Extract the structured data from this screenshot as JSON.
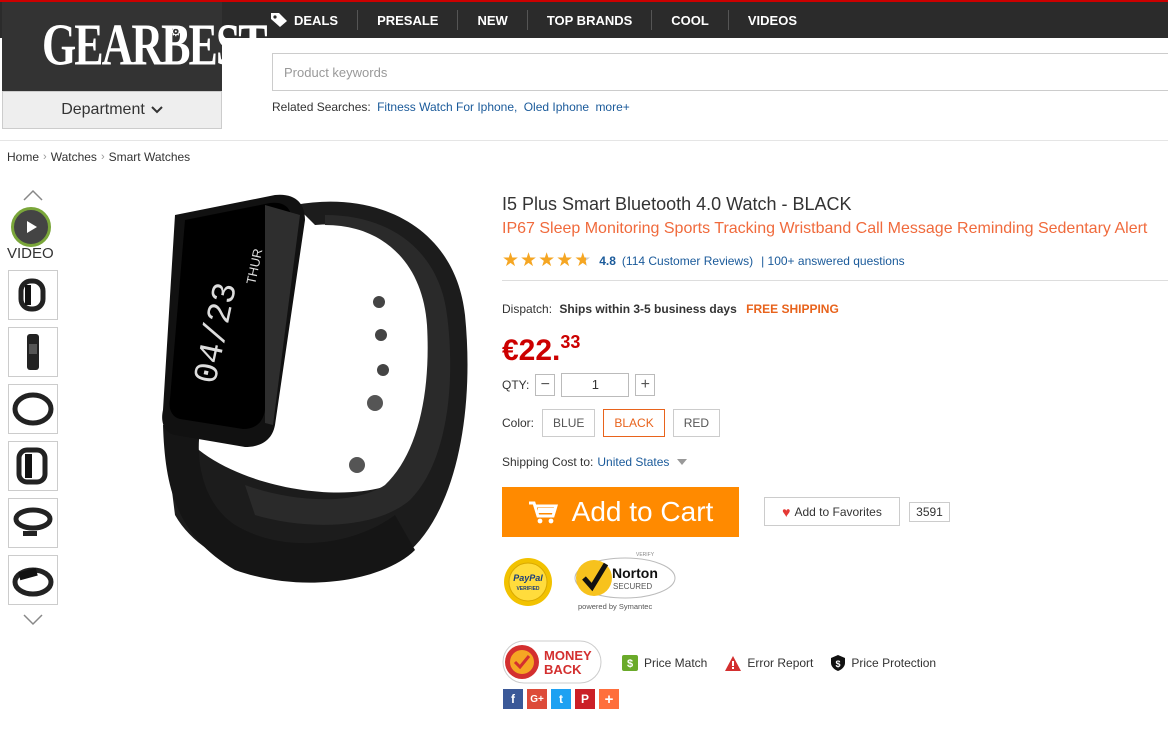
{
  "header": {
    "logo": "GEARBEST",
    "department_label": "Department",
    "nav": [
      "DEALS",
      "PRESALE",
      "NEW",
      "TOP BRANDS",
      "COOL",
      "VIDEOS"
    ],
    "search_placeholder": "Product keywords",
    "related_label": "Related Searches:",
    "related_links": [
      "Fitness Watch For Iphone,",
      "Oled Iphone",
      "more+"
    ]
  },
  "breadcrumb": [
    "Home",
    "Watches",
    "Smart Watches"
  ],
  "gallery": {
    "video_label": "VIDEO",
    "screen_date": "04/23",
    "screen_day": "THUR"
  },
  "product": {
    "title": "I5 Plus Smart Bluetooth 4.0 Watch  -  BLACK",
    "subtitle": "IP67 Sleep Monitoring Sports Tracking Wristband Call Message Reminding Sedentary Alert",
    "rating": "4.8",
    "rating_value": 4.8,
    "reviews": "(114 Customer Reviews)",
    "questions": "| 100+ answered questions",
    "dispatch_label": "Dispatch:",
    "dispatch_value": "Ships within 3-5 business days",
    "free_shipping": "FREE SHIPPING",
    "price_main": "€22.",
    "price_cents": "33",
    "qty_label": "QTY:",
    "qty_value": "1",
    "color_label": "Color:",
    "colors": [
      "BLUE",
      "BLACK",
      "RED"
    ],
    "selected_color": "BLACK",
    "shipping_label": "Shipping Cost to:",
    "shipping_country": "United States",
    "add_to_cart": "Add to Cart",
    "add_to_favorites": "Add to Favorites",
    "favorites_count": "3591"
  },
  "badges": {
    "paypal_top": "PayPal",
    "paypal_bottom": "VERIFIED",
    "norton_verify": "VERIFY",
    "norton_name": "Norton",
    "norton_secured": "SECURED",
    "norton_powered": "powered by Symantec",
    "money_back_1": "MONEY",
    "money_back_2": "BACK"
  },
  "guarantees": [
    "Price Match",
    "Error Report",
    "Price Protection"
  ],
  "colors": {
    "accent_orange": "#ff8a00",
    "price_red": "#cc0000",
    "link_blue": "#1a5a9a",
    "subtitle_orange": "#f06a3c"
  }
}
